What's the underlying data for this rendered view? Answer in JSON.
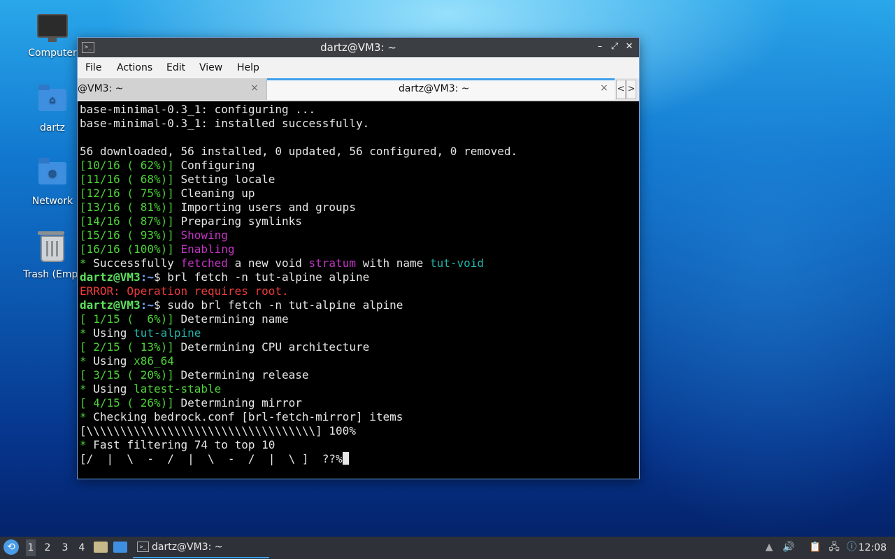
{
  "desktop": {
    "icons": [
      {
        "label": "Computer",
        "icon": "computer-icon"
      },
      {
        "label": "dartz",
        "icon": "home-folder-icon"
      },
      {
        "label": "Network",
        "icon": "network-folder-icon"
      },
      {
        "label": "Trash (Empt",
        "icon": "trash-icon"
      }
    ]
  },
  "window": {
    "title": "dartz@VM3: ~",
    "controls": {
      "minimize": "–",
      "maximize": "⤢",
      "close": "✕"
    },
    "menu": [
      "File",
      "Actions",
      "Edit",
      "View",
      "Help"
    ],
    "tabs": [
      {
        "label": "@VM3: ~",
        "active": false,
        "close": "×"
      },
      {
        "label": "dartz@VM3: ~",
        "active": true,
        "close": "×"
      }
    ],
    "tab_nav": {
      "prev": "<",
      "next": ">"
    }
  },
  "terminal": {
    "lines": [
      [
        {
          "t": "base-minimal-0.3_1: configuring ..."
        }
      ],
      [
        {
          "t": "base-minimal-0.3_1: installed successfully."
        }
      ],
      [
        {
          "t": ""
        }
      ],
      [
        {
          "t": "56 downloaded, 56 installed, 0 updated, 56 configured, 0 removed."
        }
      ],
      [
        {
          "t": "[10/16 ( 62%)]",
          "c": "green"
        },
        {
          "t": " Configuring"
        }
      ],
      [
        {
          "t": "[11/16 ( 68%)]",
          "c": "green"
        },
        {
          "t": " Setting locale"
        }
      ],
      [
        {
          "t": "[12/16 ( 75%)]",
          "c": "green"
        },
        {
          "t": " Cleaning up"
        }
      ],
      [
        {
          "t": "[13/16 ( 81%)]",
          "c": "green"
        },
        {
          "t": " Importing users and groups"
        }
      ],
      [
        {
          "t": "[14/16 ( 87%)]",
          "c": "green"
        },
        {
          "t": " Preparing symlinks"
        }
      ],
      [
        {
          "t": "[15/16 ( 93%)]",
          "c": "green"
        },
        {
          "t": " Showing",
          "c": "magenta"
        }
      ],
      [
        {
          "t": "[16/16 (100%)]",
          "c": "green"
        },
        {
          "t": " Enabling",
          "c": "magenta"
        }
      ],
      [
        {
          "t": "*",
          "c": "green"
        },
        {
          "t": " Successfully "
        },
        {
          "t": "fetched",
          "c": "magenta"
        },
        {
          "t": " a new void "
        },
        {
          "t": "stratum",
          "c": "magenta"
        },
        {
          "t": " with name "
        },
        {
          "t": "tut-void",
          "c": "cyan"
        }
      ],
      [
        {
          "t": "dartz@VM3",
          "c": "prompt"
        },
        {
          "t": ":~",
          "c": "blue"
        },
        {
          "t": "$ brl fetch -n tut-alpine alpine"
        }
      ],
      [
        {
          "t": "ERROR: Operation requires root.",
          "c": "red"
        }
      ],
      [
        {
          "t": "dartz@VM3",
          "c": "prompt"
        },
        {
          "t": ":~",
          "c": "blue"
        },
        {
          "t": "$ sudo brl fetch -n tut-alpine alpine"
        }
      ],
      [
        {
          "t": "[ 1/15 (  6%)]",
          "c": "green"
        },
        {
          "t": " Determining name"
        }
      ],
      [
        {
          "t": "*",
          "c": "green"
        },
        {
          "t": " Using "
        },
        {
          "t": "tut-alpine",
          "c": "cyan"
        }
      ],
      [
        {
          "t": "[ 2/15 ( 13%)]",
          "c": "green"
        },
        {
          "t": " Determining CPU architecture"
        }
      ],
      [
        {
          "t": "*",
          "c": "green"
        },
        {
          "t": " Using "
        },
        {
          "t": "x86_64",
          "c": "green"
        }
      ],
      [
        {
          "t": "[ 3/15 ( 20%)]",
          "c": "green"
        },
        {
          "t": " Determining release"
        }
      ],
      [
        {
          "t": "*",
          "c": "green"
        },
        {
          "t": " Using "
        },
        {
          "t": "latest-stable",
          "c": "green"
        }
      ],
      [
        {
          "t": "[ 4/15 ( 26%)]",
          "c": "green"
        },
        {
          "t": " Determining mirror"
        }
      ],
      [
        {
          "t": "*",
          "c": "green"
        },
        {
          "t": " Checking bedrock.conf [brl-fetch-mirror] items"
        }
      ],
      [
        {
          "t": "[\\\\\\\\\\\\\\\\\\\\\\\\\\\\\\\\\\\\\\\\\\\\\\\\\\\\\\\\\\\\\\\\\\\\] 100%"
        }
      ],
      [
        {
          "t": "*",
          "c": "green"
        },
        {
          "t": " Fast filtering 74 to top 10"
        }
      ],
      [
        {
          "t": "[/  |  \\  -  /  |  \\  -  /  |  \\ ]  ??%"
        },
        {
          "t": "",
          "cursor": true
        }
      ]
    ]
  },
  "taskbar": {
    "workspaces": [
      "1",
      "2",
      "3",
      "4"
    ],
    "active_workspace": "1",
    "task_label": "dartz@VM3: ~",
    "clock": "12:08",
    "tray_icons": [
      "scroll-up-icon",
      "volume-icon",
      "clipboard-icon",
      "network-icon",
      "update-notifier-icon"
    ]
  }
}
